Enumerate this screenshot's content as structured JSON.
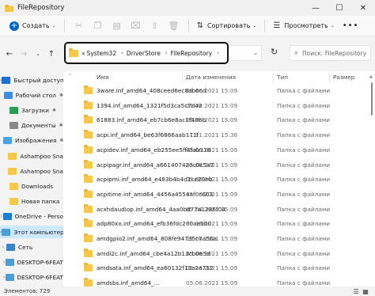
{
  "window": {
    "title": "FileRepository",
    "minimize": "—",
    "maximize": "☐",
    "close": "✕"
  },
  "toolbar": {
    "new_label": "Создать",
    "sort_label": "Сортировать",
    "view_label": "Просмотреть",
    "more": "•••",
    "icons": [
      "cut-icon",
      "copy-icon",
      "paste-icon",
      "rename-icon",
      "share-icon",
      "delete-icon"
    ]
  },
  "address": {
    "prefix": "«",
    "crumbs": [
      "System32",
      "DriverStore",
      "FileRepository"
    ],
    "separator": "›",
    "dropdown": "⌄"
  },
  "nav": {
    "back": "←",
    "forward": "→",
    "up_chevron": "⌄",
    "up": "↑",
    "refresh": "↻"
  },
  "search": {
    "icon": "⌕",
    "placeholder": "Поиск: FileRepository"
  },
  "sidebar": {
    "items": [
      {
        "label": "Быстрый доступ",
        "expander": "›",
        "icon": "star-icon",
        "color": "#1f6fce",
        "selected": false,
        "indent": 0
      },
      {
        "label": "Рабочий стол",
        "expander": "",
        "icon": "desktop-icon",
        "color": "#3a8fe0",
        "selected": false,
        "indent": 1,
        "pin": "✱"
      },
      {
        "label": "Загрузки",
        "expander": "",
        "icon": "download-icon",
        "color": "#2a9d54",
        "selected": false,
        "indent": 1,
        "pin": "✱"
      },
      {
        "label": "Документы",
        "expander": "",
        "icon": "documents-icon",
        "color": "#8a8a8a",
        "selected": false,
        "indent": 1,
        "pin": "✱"
      },
      {
        "label": "Изображения",
        "expander": "",
        "icon": "pictures-icon",
        "color": "#4ba3e6",
        "selected": false,
        "indent": 1,
        "pin": "✱"
      },
      {
        "label": "Ashampoo Sna",
        "expander": "",
        "icon": "folder-icon",
        "color": "#f6c84a",
        "selected": false,
        "indent": 1
      },
      {
        "label": "Ashampoo Sna",
        "expander": "",
        "icon": "folder-icon",
        "color": "#f6c84a",
        "selected": false,
        "indent": 1
      },
      {
        "label": "Downloads",
        "expander": "",
        "icon": "folder-icon",
        "color": "#f6c84a",
        "selected": false,
        "indent": 1
      },
      {
        "label": "Новая папка",
        "expander": "",
        "icon": "folder-icon",
        "color": "#f6c84a",
        "selected": false,
        "indent": 1
      },
      {
        "label": "OneDrive - Perso",
        "expander": "›",
        "icon": "cloud-icon",
        "color": "#1b7fd6",
        "selected": false,
        "indent": 0
      },
      {
        "label": "Этот компьютер",
        "expander": "›",
        "icon": "computer-icon",
        "color": "#4a9ed8",
        "selected": true,
        "indent": 0
      },
      {
        "label": "Сеть",
        "expander": "›",
        "icon": "network-icon",
        "color": "#3b84c9",
        "selected": false,
        "indent": 0
      },
      {
        "label": "DESKTOP-6FEAT",
        "expander": "›",
        "icon": "pc-icon",
        "color": "#4a9ed8",
        "selected": false,
        "indent": 1
      },
      {
        "label": "DESKTOP-6FEAT",
        "expander": "›",
        "icon": "pc-icon",
        "color": "#4a9ed8",
        "selected": false,
        "indent": 1
      }
    ]
  },
  "columns": {
    "name": "Имя",
    "date": "Дата изменения",
    "type": "Тип",
    "size": "Размер",
    "sort_arrow": "^"
  },
  "files": [
    {
      "name": "3ware.inf_amd64_408ceed6ec8ab6cd",
      "date": "05.06.2021 15:09",
      "type": "Папка с файлами"
    },
    {
      "name": "1394.inf_amd64_1321f5d3ca5c7d42",
      "date": "05.06.2021 15:09",
      "type": "Папка с файлами"
    },
    {
      "name": "61883.inf_amd64_eb7cb6e8ac1f48bb",
      "date": "05.06.2021 15:09",
      "type": "Папка с файлами"
    },
    {
      "name": "acpi.inf_amd64_be63f6866aab171f",
      "date": "11.11.2021 15:36",
      "type": "Папка с файлами"
    },
    {
      "name": "acpidev.inf_amd64_eb255ee5ff4fab318",
      "date": "05.06.2021 15:09",
      "type": "Папка с файлами"
    },
    {
      "name": "acpipagr.inf_amd64_a66140742dc0c5a7",
      "date": "05.06.2021 15:09",
      "type": "Папка с файлами"
    },
    {
      "name": "acpipmi.inf_amd64_e483b4b4d1ce29eb",
      "date": "05.06.2021 15:09",
      "type": "Папка с файлами"
    },
    {
      "name": "acpitime.inf_amd64_4456a4554af0c603",
      "date": "05.06.2021 15:09",
      "type": "Папка с файлами"
    },
    {
      "name": "acxhdaudiop.inf_amd64_4aa0bd77a1286f04",
      "date": "05.06.2021 15:09",
      "type": "Папка с файлами"
    },
    {
      "name": "adp80xx.inf_amd64_efb36fdc260ae9b0",
      "date": "05.06.2021 15:09",
      "type": "Папка с файлами"
    },
    {
      "name": "amdgpio2.inf_amd64_808fe94735c7a56a",
      "date": "05.06.2021 15:09",
      "type": "Папка с файлами"
    },
    {
      "name": "amdi2c.inf_amd64_cbe4a12b13cb0e5d",
      "date": "05.06.2021 15:09",
      "type": "Папка с файлами"
    },
    {
      "name": "amdsata.inf_amd64_ea60132f13a2a712",
      "date": "05.06.2021 15:09",
      "type": "Папка с файлами"
    },
    {
      "name": "amdsbs.inf_amd64_...",
      "date": "05.06.2021 15:09",
      "type": "Папка с файлами"
    }
  ],
  "status": {
    "count_text": "Элементов: 729"
  },
  "colors": {
    "accent": "#0067c0",
    "selection": "#cde8ff",
    "folder": "#f6c84a",
    "highlight_border": "#111111"
  }
}
